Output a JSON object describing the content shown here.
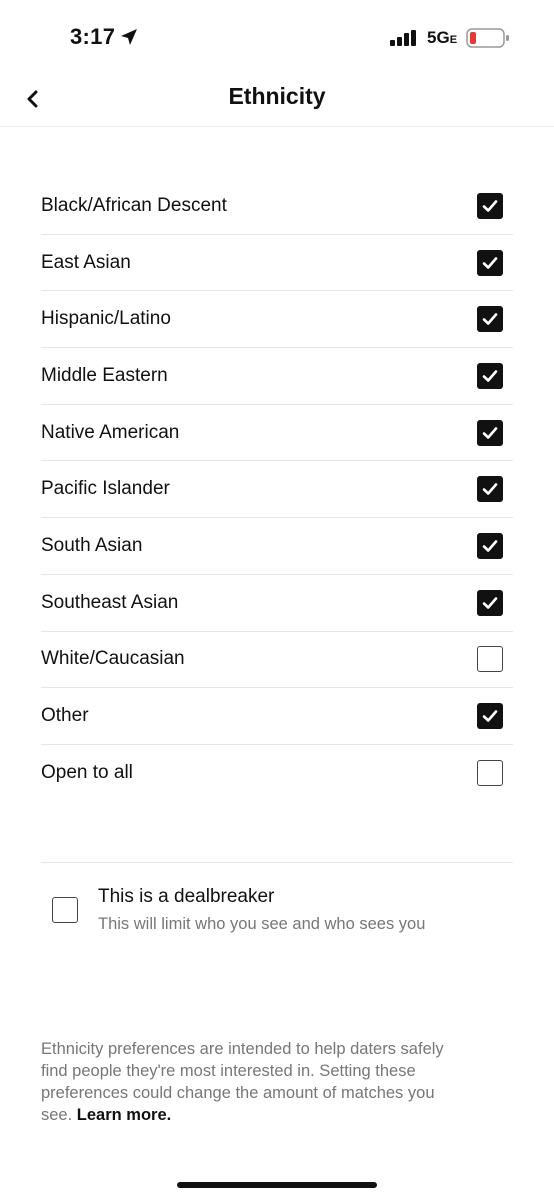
{
  "status_bar": {
    "time": "3:17",
    "network": "5G",
    "network_suffix": "E",
    "battery_color": "#e53935"
  },
  "header": {
    "title": "Ethnicity",
    "back_icon": "chevron-left-icon"
  },
  "options": [
    {
      "label": "Black/African Descent",
      "checked": true
    },
    {
      "label": "East Asian",
      "checked": true
    },
    {
      "label": "Hispanic/Latino",
      "checked": true
    },
    {
      "label": "Middle Eastern",
      "checked": true
    },
    {
      "label": "Native American",
      "checked": true
    },
    {
      "label": "Pacific Islander",
      "checked": true
    },
    {
      "label": "South Asian",
      "checked": true
    },
    {
      "label": "Southeast Asian",
      "checked": true
    },
    {
      "label": "White/Caucasian",
      "checked": false
    },
    {
      "label": "Other",
      "checked": true
    },
    {
      "label": "Open to all",
      "checked": false
    }
  ],
  "dealbreaker": {
    "title": "This is a dealbreaker",
    "subtitle": "This will limit who you see and who sees you",
    "checked": false
  },
  "footer": {
    "note_line1": "Ethnicity preferences are intended to help daters safely",
    "note_line2": "find people they're most interested in. Setting these",
    "note_line3": "preferences could change the amount of matches you",
    "note_line4": "see.",
    "link": "Learn more."
  }
}
